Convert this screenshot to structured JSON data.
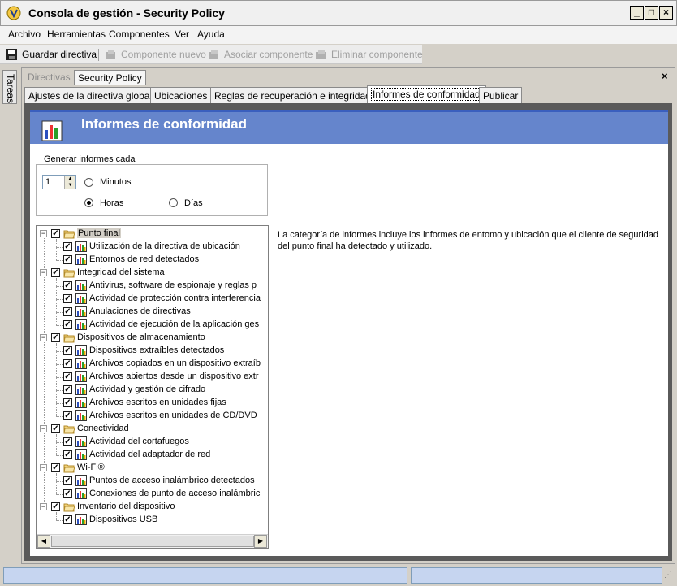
{
  "window": {
    "title": "Consola de gestión - Security Policy",
    "buttons": {
      "minimize": "_",
      "maximize": "□",
      "close": "×"
    }
  },
  "menu": [
    "Archivo",
    "Herramientas",
    "Componentes",
    "Ver",
    "Ayuda"
  ],
  "toolbar": {
    "save": "Guardar directiva",
    "new_component": "Componente nuevo",
    "associate_component": "Asociar componente",
    "delete_component": "Eliminar componente"
  },
  "side_tab": {
    "label": "Tareas"
  },
  "doc_tabs": [
    {
      "label": "Directivas",
      "active": false
    },
    {
      "label": "Security Policy",
      "active": true
    }
  ],
  "close_doc": "×",
  "section_tabs": [
    {
      "label": "Ajustes de la directiva global",
      "active": false
    },
    {
      "label": "Ubicaciones",
      "active": false
    },
    {
      "label": "Reglas de recuperación e integridad",
      "active": false
    },
    {
      "label": "Informes de conformidad",
      "active": true
    },
    {
      "label": "Publicar",
      "active": false
    }
  ],
  "panel": {
    "title": "Informes de conformidad",
    "interval": {
      "legend": "Generar informes cada",
      "value": "1",
      "options": [
        {
          "label": "Minutos",
          "checked": false
        },
        {
          "label": "Horas",
          "checked": true
        },
        {
          "label": "Días",
          "checked": false
        }
      ]
    },
    "description": "La categoría de informes incluye los informes de entomo y ubicación que el cliente de seguridad del punto final ha detectado y utilizado."
  },
  "tree": [
    {
      "label": "Punto final",
      "checked": true,
      "selected": true,
      "children": [
        "Utilización de la directiva de ubicación",
        "Entornos de red detectados"
      ]
    },
    {
      "label": "Integridad del sistema",
      "checked": true,
      "children": [
        "Antivirus, software de espionaje y reglas p",
        "Actividad de protección contra interferencia",
        "Anulaciones de directivas",
        "Actividad de ejecución de la aplicación ges"
      ]
    },
    {
      "label": "Dispositivos de almacenamiento",
      "checked": true,
      "children": [
        "Dispositivos extraíbles detectados",
        "Archivos copiados en un dispositivo extraíb",
        "Archivos abiertos desde un dispositivo extr",
        "Actividad y gestión de cifrado",
        "Archivos escritos en unidades fijas",
        "Archivos escritos en unidades de CD/DVD"
      ]
    },
    {
      "label": "Conectividad",
      "checked": true,
      "children": [
        "Actividad del cortafuegos",
        "Actividad del adaptador de red"
      ]
    },
    {
      "label": "Wi-Fi®",
      "checked": true,
      "children": [
        "Puntos de acceso inalámbrico detectados",
        "Conexiones de punto de acceso inalámbric"
      ]
    },
    {
      "label": "Inventario del dispositivo",
      "checked": true,
      "children": [
        "Dispositivos USB"
      ]
    }
  ],
  "colors": {
    "header": "#6585cc",
    "status": "#c6d5f0"
  }
}
